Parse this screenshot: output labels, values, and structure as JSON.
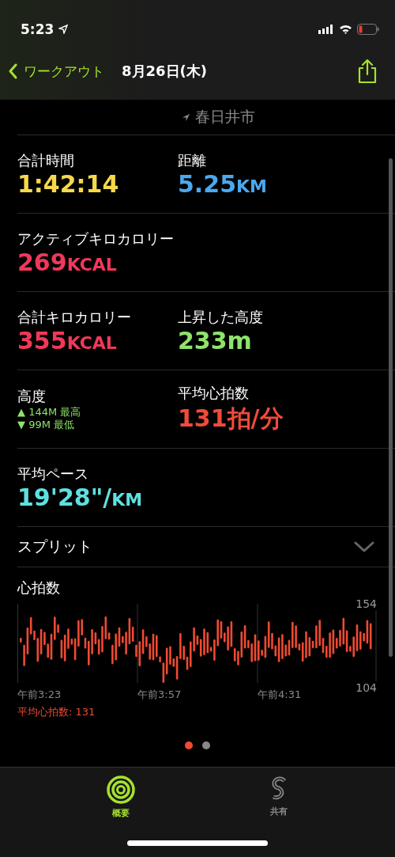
{
  "status_bar": {
    "time": "5:23"
  },
  "nav": {
    "back": "ワークアウト",
    "title": "8月26日(木)"
  },
  "location": "春日井市",
  "stat_rows": [
    {
      "cells": [
        {
          "label": "合計時間",
          "value": "1:42:14",
          "color": "#f5d94a"
        },
        {
          "label": "距離",
          "value": "5.25",
          "unit": "KM",
          "color": "#4aa8f0"
        }
      ]
    },
    {
      "cells": [
        {
          "label": "アクティブキロカロリー",
          "value": "269",
          "unit": "KCAL",
          "color": "#f0385a"
        }
      ]
    },
    {
      "cells": [
        {
          "label": "合計キロカロリー",
          "value": "355",
          "unit": "KCAL",
          "color": "#f0385a"
        },
        {
          "label": "上昇した高度",
          "value": "233m",
          "color": "#8fe36a"
        }
      ]
    },
    {
      "cells": [
        {
          "label": "高度",
          "kind": "elevation",
          "high": "▲ 144M 最高",
          "low": "▼ 99M 最低",
          "color": "#8fe36a"
        },
        {
          "label": "平均心拍数",
          "value": "131拍/分",
          "color": "#f04a3a"
        }
      ]
    },
    {
      "cells": [
        {
          "label": "平均ペース",
          "value": "19'28\"/",
          "unit": "KM",
          "color": "#5ee0e0"
        }
      ]
    }
  ],
  "splits": {
    "label": "スプリット",
    "expanded": false
  },
  "heart_rate": {
    "title": "心拍数",
    "y_max": "154",
    "y_min": "104",
    "times": [
      "午前3:23",
      "午前3:57",
      "午前4:31"
    ],
    "average": "平均心拍数: 131"
  },
  "pages": [
    {
      "selected": true
    },
    {
      "selected": false
    }
  ],
  "tabs": [
    {
      "label": "概要",
      "selected": true,
      "kind": "summary"
    },
    {
      "label": "共有",
      "selected": false,
      "kind": "sharing"
    }
  ]
}
